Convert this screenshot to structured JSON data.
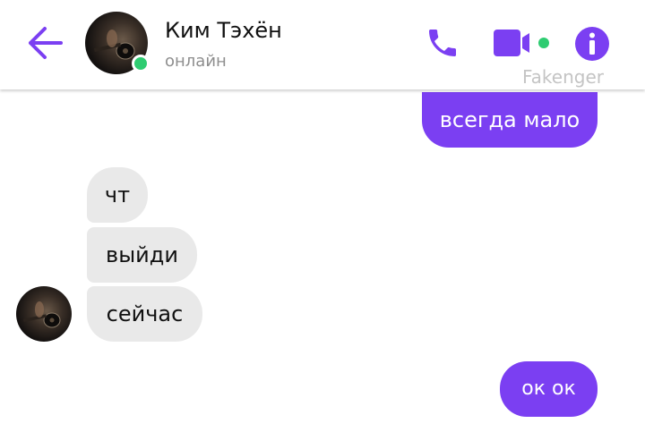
{
  "header": {
    "contact_name": "Ким Тэхён",
    "status": "онлайн",
    "icons": {
      "back": "back-arrow-icon",
      "call": "phone-icon",
      "video": "video-camera-icon",
      "info": "info-icon"
    },
    "accent_color": "#7b3ff2",
    "online_color": "#2ecc71"
  },
  "watermark": "Fakenger",
  "messages": [
    {
      "direction": "outgoing",
      "text": "всегда мало"
    },
    {
      "direction": "incoming",
      "text": "чт"
    },
    {
      "direction": "incoming",
      "text": "выйди"
    },
    {
      "direction": "incoming",
      "text": "сейчас"
    },
    {
      "direction": "outgoing",
      "text": "ок ок"
    }
  ]
}
